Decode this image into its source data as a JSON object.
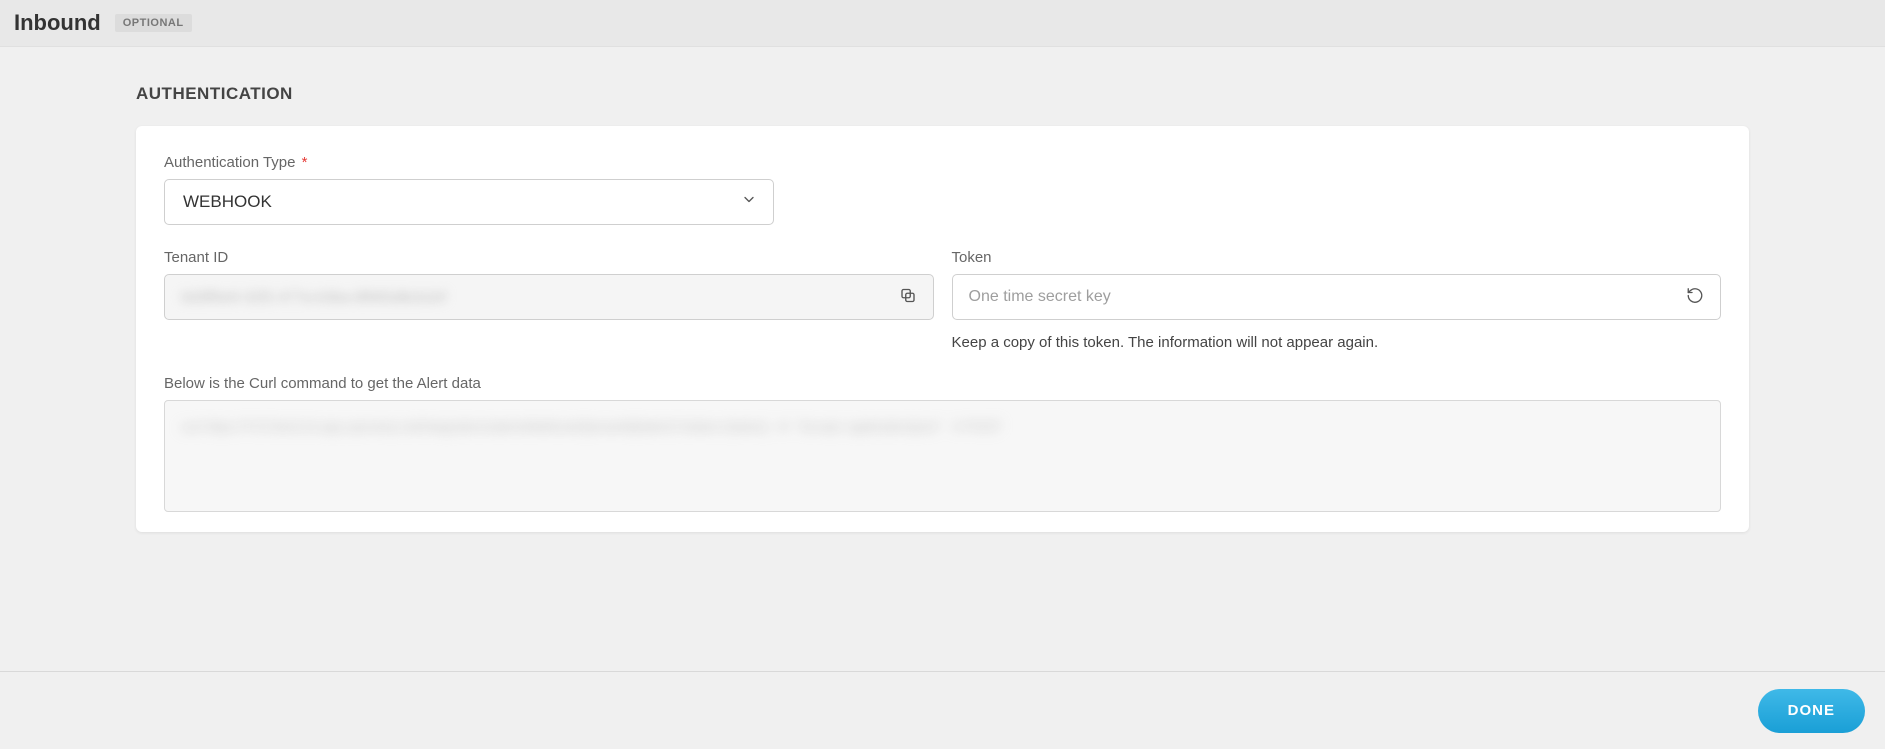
{
  "header": {
    "title": "Inbound",
    "badge": "OPTIONAL"
  },
  "section": {
    "title": "AUTHENTICATION"
  },
  "auth_type": {
    "label": "Authentication Type",
    "required_marker": "*",
    "value": "WEBHOOK"
  },
  "tenant": {
    "label": "Tenant ID",
    "masked_value": "0d3ff0e9-32f2-477a-b3ba-8f965d8cb2ef"
  },
  "token": {
    "label": "Token",
    "placeholder": "One time secret key",
    "helper": "Keep a copy of this token. The information will not appear again."
  },
  "curl": {
    "heading": "Below is the Curl command to get the Alert data",
    "masked_command": "curl https://YCC/tenit.int.app.opsramp.net/integrations/alertsWebhook/{tenantId}/alerts?vtoken={token}  -H  \"Accept: application/json\"  -X POST"
  },
  "footer": {
    "done_label": "DONE"
  }
}
